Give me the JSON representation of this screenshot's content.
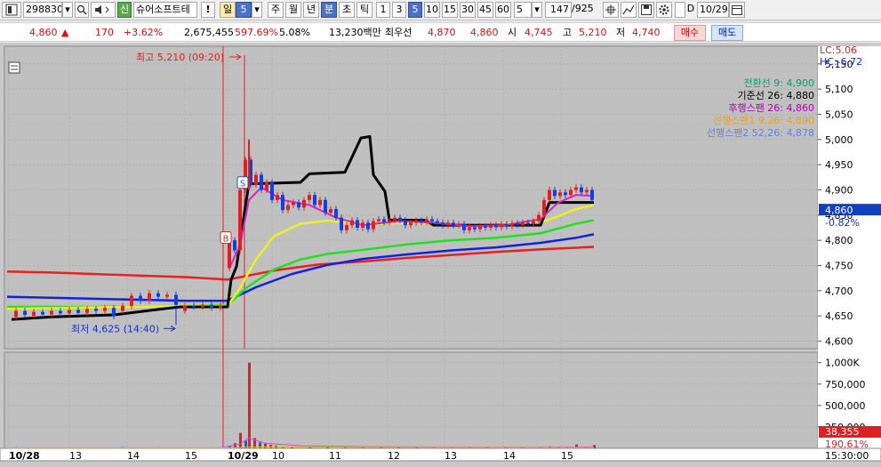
{
  "toolbar": {
    "code": "298830",
    "credit_label": "신",
    "stock_name": "슈어소프트테",
    "alert_label": "!",
    "period_items": [
      "일",
      "주",
      "월",
      "년",
      "분",
      "초",
      "틱"
    ],
    "minute_value": "5",
    "interval_items": [
      "1",
      "3",
      "5",
      "10",
      "15",
      "30",
      "45",
      "60"
    ],
    "count_value": "5",
    "page_value": "147",
    "page_total": "/925",
    "d_label": "D",
    "date_value": "10/29"
  },
  "quote": {
    "price": "4,860",
    "arrow": "▲",
    "change": "170",
    "change_pct": "+3.62%",
    "volume": "2,675,455",
    "volume_ratio": "597.69%",
    "turnover": "5.08%",
    "amount": "13,230백만",
    "best_label": "최우선",
    "best_ask": "4,870",
    "best_bid": "4,860",
    "open_label": "시",
    "open": "4,745",
    "high_label": "고",
    "high": "5,210",
    "low_label": "저",
    "low": "4,740",
    "buy_label": "매수",
    "sell_label": "매도"
  },
  "chart_data": {
    "type": "candlestick",
    "indicator_header": {
      "lc": "LC:5.06",
      "hc": "HC:-6.72"
    },
    "legend": [
      {
        "label": "전환선 9: 4,900",
        "color": "#0a9a78"
      },
      {
        "label": "기준선 26: 4,880",
        "color": "#000000"
      },
      {
        "label": "후행스팬 26: 4,860",
        "color": "#b400b4"
      },
      {
        "label": "선행스팬1 9,26: 4,890",
        "color": "#e8a020"
      },
      {
        "label": "선행스팬2 52,26: 4,878",
        "color": "#6080e0"
      }
    ],
    "price_axis": {
      "ticks": [
        "5,150",
        "5,100",
        "5,050",
        "5,000",
        "4,950",
        "4,900",
        "4,850",
        "4,800",
        "4,750",
        "4,700",
        "4,650",
        "4,600"
      ],
      "ylim": [
        4585,
        5185
      ]
    },
    "current_price_tag": {
      "price": "4,860",
      "pct": "-0.82%"
    },
    "high_annotation": "최고 5,210 (09:20)",
    "low_annotation": "최저 4,625 (14:40)",
    "markers": [
      "S",
      "B"
    ],
    "volume_axis": {
      "ticks": [
        "1,000K",
        "750,000",
        "500,000",
        "250,000"
      ],
      "ymax": 1080000
    },
    "volume_tag": {
      "value": "38,355",
      "pct": "190.61%"
    },
    "x_labels": [
      "10/28",
      "13",
      "14",
      "15",
      "10/29",
      "10",
      "11",
      "12",
      "13",
      "14",
      "15"
    ],
    "time_display": "15:30:00",
    "series": [
      {
        "name": "MA red",
        "color": "#e82020",
        "values": [
          [
            0,
            4738
          ],
          [
            50,
            4736
          ],
          [
            100,
            4733
          ],
          [
            150,
            4730
          ],
          [
            200,
            4727
          ],
          [
            248,
            4722
          ],
          [
            300,
            4740
          ],
          [
            350,
            4752
          ],
          [
            400,
            4758
          ],
          [
            450,
            4765
          ],
          [
            500,
            4771
          ],
          [
            550,
            4777
          ],
          [
            600,
            4782
          ],
          [
            660,
            4787
          ]
        ]
      },
      {
        "name": "MA blue",
        "color": "#1020e0",
        "values": [
          [
            0,
            4688
          ],
          [
            50,
            4686
          ],
          [
            100,
            4684
          ],
          [
            150,
            4682
          ],
          [
            200,
            4680
          ],
          [
            248,
            4680
          ],
          [
            280,
            4707
          ],
          [
            320,
            4733
          ],
          [
            360,
            4751
          ],
          [
            400,
            4763
          ],
          [
            450,
            4772
          ],
          [
            500,
            4780
          ],
          [
            550,
            4786
          ],
          [
            600,
            4795
          ],
          [
            640,
            4805
          ],
          [
            660,
            4812
          ]
        ]
      },
      {
        "name": "MA green",
        "color": "#20e020",
        "values": [
          [
            0,
            4668
          ],
          [
            100,
            4668
          ],
          [
            200,
            4670
          ],
          [
            248,
            4672
          ],
          [
            270,
            4707
          ],
          [
            300,
            4742
          ],
          [
            330,
            4762
          ],
          [
            360,
            4773
          ],
          [
            400,
            4781
          ],
          [
            450,
            4792
          ],
          [
            500,
            4800
          ],
          [
            550,
            4805
          ],
          [
            600,
            4814
          ],
          [
            640,
            4833
          ],
          [
            660,
            4840
          ]
        ]
      },
      {
        "name": "MA yellow",
        "color": "#f0f020",
        "values": [
          [
            0,
            4664
          ],
          [
            100,
            4667
          ],
          [
            200,
            4670
          ],
          [
            248,
            4670
          ],
          [
            260,
            4700
          ],
          [
            280,
            4762
          ],
          [
            300,
            4808
          ],
          [
            330,
            4833
          ],
          [
            360,
            4839
          ],
          [
            400,
            4832
          ],
          [
            450,
            4835
          ],
          [
            500,
            4831
          ],
          [
            550,
            4832
          ],
          [
            600,
            4835
          ],
          [
            620,
            4848
          ],
          [
            640,
            4862
          ],
          [
            660,
            4870
          ]
        ]
      },
      {
        "name": "기준선",
        "color": "#000000",
        "values": [
          [
            5,
            4643
          ],
          [
            50,
            4648
          ],
          [
            120,
            4652
          ],
          [
            180,
            4665
          ],
          [
            195,
            4668
          ],
          [
            248,
            4668
          ],
          [
            252,
            4722
          ],
          [
            258,
            4748
          ],
          [
            262,
            4795
          ],
          [
            268,
            4868
          ],
          [
            272,
            4912
          ],
          [
            330,
            4915
          ],
          [
            340,
            4932
          ],
          [
            380,
            4935
          ],
          [
            398,
            5003
          ],
          [
            408,
            5006
          ],
          [
            412,
            4930
          ],
          [
            425,
            4897
          ],
          [
            430,
            4840
          ],
          [
            470,
            4840
          ],
          [
            480,
            4830
          ],
          [
            510,
            4830
          ],
          [
            600,
            4830
          ],
          [
            610,
            4875
          ],
          [
            660,
            4875
          ]
        ]
      }
    ],
    "candles": [
      [
        10,
        4648,
        4660
      ],
      [
        20,
        4660,
        4652
      ],
      [
        30,
        4650,
        4658
      ],
      [
        40,
        4658,
        4653
      ],
      [
        50,
        4653,
        4660
      ],
      [
        60,
        4660,
        4655
      ],
      [
        70,
        4655,
        4662
      ],
      [
        80,
        4662,
        4656
      ],
      [
        90,
        4656,
        4664
      ],
      [
        100,
        4664,
        4660
      ],
      [
        110,
        4660,
        4666
      ],
      [
        120,
        4666,
        4650
      ],
      [
        130,
        4660,
        4670
      ],
      [
        140,
        4670,
        4690
      ],
      [
        150,
        4690,
        4680
      ],
      [
        160,
        4680,
        4695
      ],
      [
        170,
        4695,
        4688
      ],
      [
        180,
        4688,
        4692
      ],
      [
        190,
        4692,
        4672
      ],
      [
        200,
        4660,
        4670
      ],
      [
        210,
        4670,
        4668
      ],
      [
        220,
        4668,
        4672
      ],
      [
        230,
        4672,
        4666
      ],
      [
        240,
        4666,
        4670
      ],
      [
        250,
        4745,
        4800
      ],
      [
        256,
        4800,
        4780
      ],
      [
        262,
        4780,
        4900
      ],
      [
        268,
        4900,
        4960
      ],
      [
        274,
        4960,
        4910
      ],
      [
        280,
        4910,
        4930
      ],
      [
        286,
        4930,
        4900
      ],
      [
        292,
        4900,
        4915
      ],
      [
        298,
        4915,
        4880
      ],
      [
        304,
        4880,
        4890
      ],
      [
        310,
        4890,
        4860
      ],
      [
        316,
        4860,
        4870
      ],
      [
        322,
        4870,
        4875
      ],
      [
        328,
        4875,
        4865
      ],
      [
        334,
        4865,
        4880
      ],
      [
        340,
        4880,
        4890
      ],
      [
        346,
        4890,
        4870
      ],
      [
        352,
        4870,
        4880
      ],
      [
        358,
        4880,
        4855
      ],
      [
        364,
        4855,
        4862
      ],
      [
        370,
        4862,
        4845
      ],
      [
        376,
        4845,
        4820
      ],
      [
        382,
        4820,
        4830
      ],
      [
        388,
        4830,
        4840
      ],
      [
        394,
        4840,
        4825
      ],
      [
        400,
        4825,
        4835
      ],
      [
        406,
        4835,
        4822
      ],
      [
        412,
        4822,
        4838
      ],
      [
        418,
        4838,
        4842
      ],
      [
        424,
        4842,
        4836
      ],
      [
        430,
        4836,
        4840
      ],
      [
        436,
        4840,
        4845
      ],
      [
        442,
        4845,
        4840
      ],
      [
        448,
        4840,
        4830
      ],
      [
        454,
        4830,
        4835
      ],
      [
        460,
        4835,
        4840
      ],
      [
        466,
        4840,
        4836
      ],
      [
        472,
        4836,
        4842
      ],
      [
        478,
        4842,
        4838
      ],
      [
        484,
        4838,
        4835
      ],
      [
        490,
        4835,
        4830
      ],
      [
        496,
        4830,
        4835
      ],
      [
        502,
        4835,
        4830
      ],
      [
        508,
        4830,
        4832
      ],
      [
        514,
        4832,
        4820
      ],
      [
        520,
        4820,
        4826
      ],
      [
        526,
        4826,
        4822
      ],
      [
        532,
        4822,
        4828
      ],
      [
        538,
        4828,
        4825
      ],
      [
        544,
        4825,
        4830
      ],
      [
        550,
        4830,
        4826
      ],
      [
        556,
        4826,
        4832
      ],
      [
        562,
        4832,
        4828
      ],
      [
        568,
        4828,
        4834
      ],
      [
        574,
        4834,
        4830
      ],
      [
        580,
        4830,
        4835
      ],
      [
        586,
        4835,
        4832
      ],
      [
        592,
        4832,
        4838
      ],
      [
        598,
        4838,
        4850
      ],
      [
        604,
        4850,
        4880
      ],
      [
        610,
        4880,
        4900
      ],
      [
        616,
        4900,
        4888
      ],
      [
        622,
        4888,
        4895
      ],
      [
        628,
        4895,
        4890
      ],
      [
        634,
        4890,
        4900
      ],
      [
        640,
        4900,
        4905
      ],
      [
        646,
        4905,
        4895
      ],
      [
        652,
        4895,
        4900
      ],
      [
        658,
        4900,
        4880
      ]
    ],
    "volumes": [
      [
        10,
        12000
      ],
      [
        30,
        8000
      ],
      [
        50,
        10000
      ],
      [
        70,
        9000
      ],
      [
        90,
        11000
      ],
      [
        110,
        9000
      ],
      [
        130,
        14000
      ],
      [
        150,
        10000
      ],
      [
        170,
        12000
      ],
      [
        190,
        9000
      ],
      [
        210,
        8000
      ],
      [
        230,
        11000
      ],
      [
        250,
        30000
      ],
      [
        256,
        60000
      ],
      [
        262,
        180000
      ],
      [
        268,
        90000
      ],
      [
        272,
        1000000
      ],
      [
        278,
        120000
      ],
      [
        284,
        70000
      ],
      [
        290,
        60000
      ],
      [
        296,
        40000
      ],
      [
        302,
        30000
      ],
      [
        310,
        20000
      ],
      [
        320,
        18000
      ],
      [
        340,
        15000
      ],
      [
        360,
        14000
      ],
      [
        380,
        12000
      ],
      [
        400,
        12000
      ],
      [
        420,
        11000
      ],
      [
        440,
        10000
      ],
      [
        460,
        10000
      ],
      [
        480,
        9000
      ],
      [
        500,
        9000
      ],
      [
        520,
        8000
      ],
      [
        540,
        9000
      ],
      [
        560,
        9000
      ],
      [
        580,
        8000
      ],
      [
        600,
        15000
      ],
      [
        610,
        22000
      ],
      [
        620,
        18000
      ],
      [
        630,
        14000
      ],
      [
        640,
        45000
      ],
      [
        650,
        12000
      ],
      [
        660,
        38355
      ]
    ]
  }
}
